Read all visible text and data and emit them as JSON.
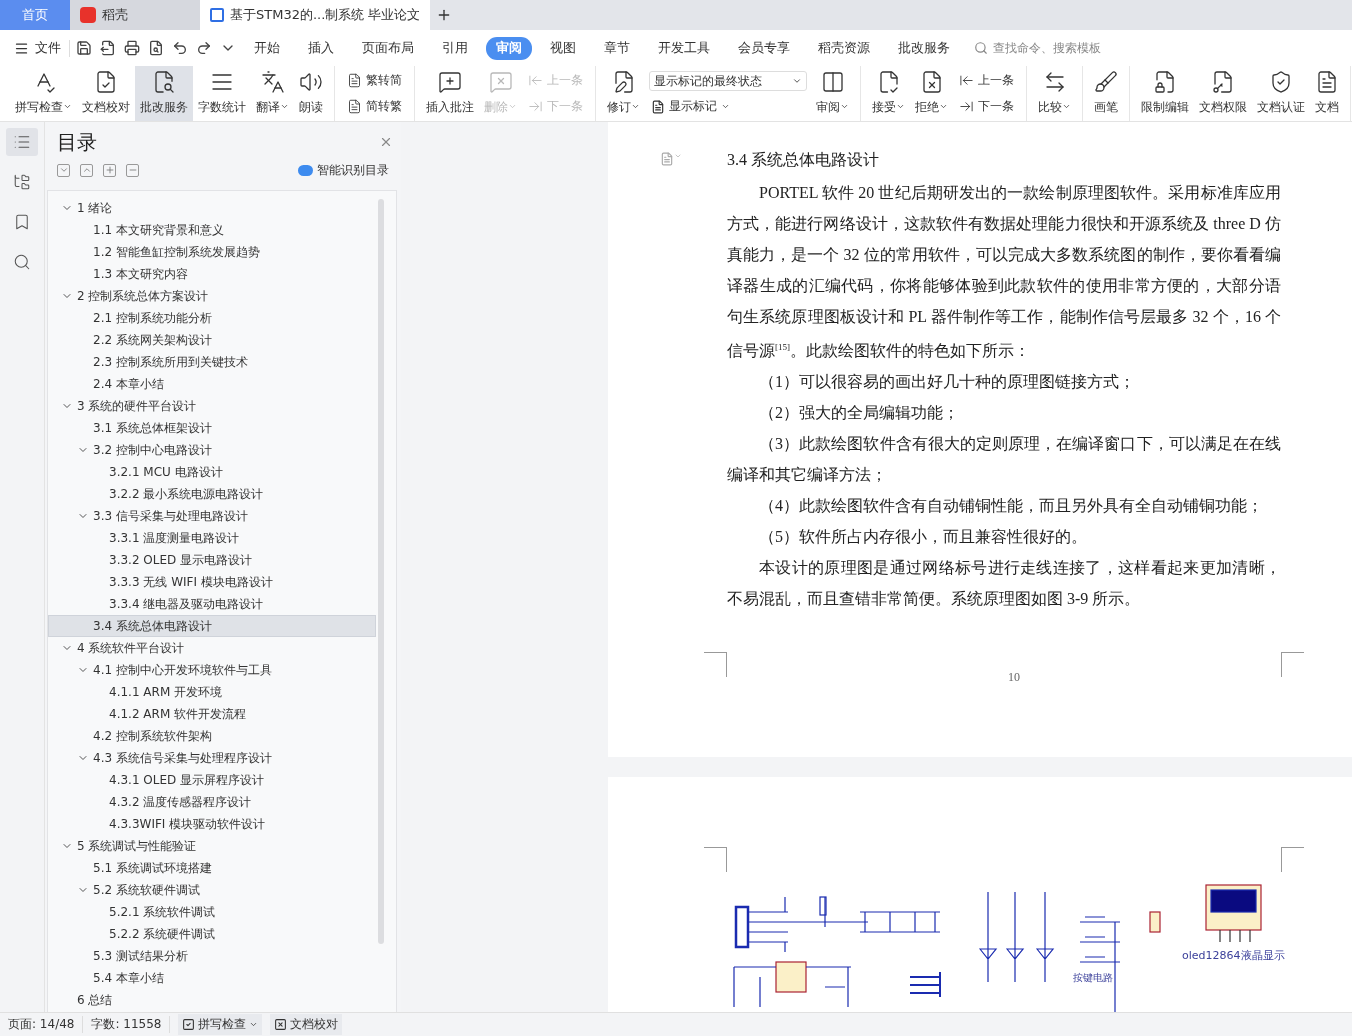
{
  "tabs": [
    {
      "label": "首页",
      "kind": "home",
      "selected": false
    },
    {
      "label": "稻壳",
      "kind": "app",
      "selected": false
    },
    {
      "label": "基于STM32的...制系统 毕业论文",
      "kind": "doc",
      "selected": true
    }
  ],
  "menu": {
    "file": "文件",
    "items": [
      {
        "label": "开始",
        "selected": false
      },
      {
        "label": "插入",
        "selected": false
      },
      {
        "label": "页面布局",
        "selected": false
      },
      {
        "label": "引用",
        "selected": false
      },
      {
        "label": "审阅",
        "selected": true
      },
      {
        "label": "视图",
        "selected": false
      },
      {
        "label": "章节",
        "selected": false
      },
      {
        "label": "开发工具",
        "selected": false
      },
      {
        "label": "会员专享",
        "selected": false
      },
      {
        "label": "稻壳资源",
        "selected": false
      },
      {
        "label": "批改服务",
        "selected": false
      }
    ],
    "search": {
      "placeholder": "查找命令、搜索模板"
    }
  },
  "ribbon": [
    [
      {
        "kind": "big",
        "label": "拼写检查",
        "caret": true,
        "disabled": false,
        "selected": false
      },
      {
        "kind": "big",
        "label": "文档校对",
        "caret": false,
        "disabled": false,
        "selected": false
      },
      {
        "kind": "big",
        "label": "批改服务",
        "caret": false,
        "disabled": false,
        "selected": true
      },
      {
        "kind": "big",
        "label": "字数统计",
        "caret": false,
        "disabled": false,
        "selected": false
      },
      {
        "kind": "big",
        "label": "翻译",
        "caret": true,
        "disabled": false,
        "selected": false
      },
      {
        "kind": "big",
        "label": "朗读",
        "caret": false,
        "disabled": false,
        "selected": false
      }
    ],
    [
      {
        "kind": "stack",
        "items": [
          {
            "label": "繁转简",
            "disabled": false
          },
          {
            "label": "简转繁",
            "disabled": false
          }
        ]
      }
    ],
    [
      {
        "kind": "big",
        "label": "插入批注",
        "caret": false,
        "disabled": false,
        "selected": false
      },
      {
        "kind": "big",
        "label": "删除",
        "caret": true,
        "disabled": true,
        "selected": false
      },
      {
        "kind": "stack",
        "items": [
          {
            "label": "上一条",
            "disabled": true
          },
          {
            "label": "下一条",
            "disabled": true
          }
        ]
      }
    ],
    [
      {
        "kind": "big",
        "label": "修订",
        "caret": true,
        "disabled": false,
        "selected": false
      },
      {
        "kind": "select",
        "value": "显示标记的最终状态",
        "sub": "显示标记"
      },
      {
        "kind": "big",
        "label": "审阅",
        "caret": true,
        "disabled": false,
        "selected": false
      }
    ],
    [
      {
        "kind": "big",
        "label": "接受",
        "caret": true,
        "disabled": false,
        "selected": false
      },
      {
        "kind": "big",
        "label": "拒绝",
        "caret": true,
        "disabled": false,
        "selected": false
      },
      {
        "kind": "stack",
        "items": [
          {
            "label": "上一条",
            "disabled": false
          },
          {
            "label": "下一条",
            "disabled": false
          }
        ]
      }
    ],
    [
      {
        "kind": "big",
        "label": "比较",
        "caret": true,
        "disabled": false,
        "selected": false
      }
    ],
    [
      {
        "kind": "big",
        "label": "画笔",
        "caret": false,
        "disabled": false,
        "selected": false
      }
    ],
    [
      {
        "kind": "big",
        "label": "限制编辑",
        "caret": false,
        "disabled": false,
        "selected": false
      },
      {
        "kind": "big",
        "label": "文档权限",
        "caret": false,
        "disabled": false,
        "selected": false
      },
      {
        "kind": "big",
        "label": "文档认证",
        "caret": false,
        "disabled": false,
        "selected": false
      },
      {
        "kind": "big",
        "label": "文档",
        "caret": false,
        "disabled": false,
        "selected": false
      }
    ]
  ],
  "toc": {
    "title": "目录",
    "smart": "智能识别目录",
    "items": [
      {
        "label": "1  绪论",
        "selected": false,
        "expanded": true,
        "children": [
          {
            "label": "1.1 本文研究背景和意义",
            "selected": false
          },
          {
            "label": "1.2 智能鱼缸控制系统发展趋势",
            "selected": false
          },
          {
            "label": "1.3 本文研究内容",
            "selected": false
          }
        ]
      },
      {
        "label": "2  控制系统总体方案设计",
        "selected": false,
        "expanded": true,
        "children": [
          {
            "label": "2.1 控制系统功能分析",
            "selected": false
          },
          {
            "label": "2.2 系统网关架构设计",
            "selected": false
          },
          {
            "label": "2.3 控制系统所用到关键技术",
            "selected": false
          },
          {
            "label": "2.4 本章小结",
            "selected": false
          }
        ]
      },
      {
        "label": "3  系统的硬件平台设计",
        "selected": false,
        "expanded": true,
        "children": [
          {
            "label": "3.1 系统总体框架设计",
            "selected": false
          },
          {
            "label": "3.2 控制中心电路设计",
            "selected": false,
            "expanded": true,
            "children": [
              {
                "label": "3.2.1 MCU 电路设计",
                "selected": false
              },
              {
                "label": "3.2.2 最小系统电源电路设计",
                "selected": false
              }
            ]
          },
          {
            "label": "3.3 信号采集与处理电路设计",
            "selected": false,
            "expanded": true,
            "children": [
              {
                "label": "3.3.1 温度测量电路设计",
                "selected": false
              },
              {
                "label": "3.3.2 OLED 显示电路设计",
                "selected": false
              },
              {
                "label": "3.3.3 无线 WIFI 模块电路设计",
                "selected": false
              },
              {
                "label": "3.3.4 继电器及驱动电路设计",
                "selected": false
              }
            ]
          },
          {
            "label": "3.4 系统总体电路设计",
            "selected": true
          }
        ]
      },
      {
        "label": "4  系统软件平台设计",
        "selected": false,
        "expanded": true,
        "children": [
          {
            "label": "4.1 控制中心开发环境软件与工具",
            "selected": false,
            "expanded": true,
            "children": [
              {
                "label": "4.1.1 ARM 开发环境",
                "selected": false
              },
              {
                "label": "4.1.2 ARM 软件开发流程",
                "selected": false
              }
            ]
          },
          {
            "label": "4.2 控制系统软件架构",
            "selected": false
          },
          {
            "label": "4.3 系统信号采集与处理程序设计",
            "selected": false,
            "expanded": true,
            "children": [
              {
                "label": "4.3.1 OLED 显示屏程序设计",
                "selected": false
              },
              {
                "label": "4.3.2 温度传感器程序设计",
                "selected": false
              },
              {
                "label": "4.3.3WIFI 模块驱动软件设计",
                "selected": false
              }
            ]
          }
        ]
      },
      {
        "label": "5  系统调试与性能验证",
        "selected": false,
        "expanded": true,
        "children": [
          {
            "label": "5.1 系统调试环境搭建",
            "selected": false
          },
          {
            "label": "5.2 系统软硬件调试",
            "selected": false,
            "expanded": true,
            "children": [
              {
                "label": "5.2.1 系统软件调试",
                "selected": false
              },
              {
                "label": "5.2.2 系统硬件调试",
                "selected": false
              }
            ]
          },
          {
            "label": "5.3 测试结果分析",
            "selected": false
          },
          {
            "label": "5.4 本章小结",
            "selected": false
          }
        ]
      },
      {
        "label": "6  总结",
        "selected": false
      }
    ]
  },
  "document": {
    "heading": "3.4 系统总体电路设计",
    "paragraphs": [
      {
        "text": "PORTEL 软件 20 世纪后期研发出的一款绘制原理图软件。采用标准库应用方式，能进行网络设计，这款软件有数据处理能力很快和开源系统及 three D 仿真能力，是一个 32 位的常用软件，可以完成大多数系统图的制作，要你看看编译器生成的汇编代码，你将能够体验到此款软件的使用非常方便的，大部分语句生系统原理图板设计和 PL 器件制作等工作，能制作信号层最多 32 个，16 个信号源$^{[15]}$。此款绘图软件的特色如下所示："
      },
      {
        "text": "（1）可以很容易的画出好几十种的原理图链接方式；"
      },
      {
        "text": "（2）强大的全局编辑功能；"
      },
      {
        "text": "（3）此款绘图软件含有很大的定则原理，在编译窗口下，可以满足在在线编译和其它编译方法；"
      },
      {
        "text": "（4）此款绘图软件含有自动铺铜性能，而且另外具有全自动铺铜功能；"
      },
      {
        "text": "（5）软件所占内存很小，而且兼容性很好的。"
      },
      {
        "text": "本设计的原理图是通过网络标号进行走线连接了，这样看起来更加清晰，不易混乱，而且查错非常简便。系统原理图如图 3-9 所示。"
      }
    ],
    "page_number": "10",
    "schematic_labels": [
      "按键电路",
      "oled12864液晶显示"
    ]
  },
  "status": {
    "page": "页面: 14/48",
    "words": "字数: 11558",
    "spell": "拼写检查",
    "proof": "文档校对"
  }
}
